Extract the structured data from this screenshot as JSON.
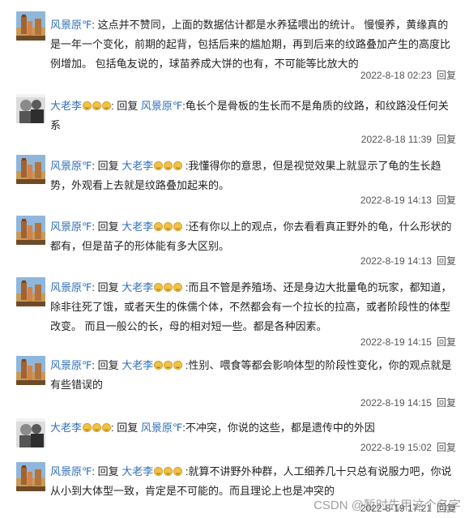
{
  "comments": [
    {
      "avatar": "landscape",
      "author": "风景原℉",
      "reply_prefix": "",
      "reply_to": "",
      "reply_to_emoji": 0,
      "sep": ": ",
      "text": "这点并不赞同，上面的数据估计都是水养猛喂出的统计。 慢慢养，黄缘真的是一年一个变化，前期的起背，包括后来的尴尬期，再到后来的纹路叠加产生的高度比例增加。 包括龟友说的，球苗养成大饼的也有，不可能等比放大的",
      "time": "2022-8-18 02:23",
      "reply": "回复"
    },
    {
      "avatar": "portrait",
      "author": "大老李",
      "author_emoji": 3,
      "reply_prefix": ": 回复 ",
      "reply_to": "风景原℉",
      "reply_to_emoji": 0,
      "sep": ":",
      "text": "龟长个是骨板的生长而不是角质的纹路，和纹路没任何关系",
      "time": "2022-8-18 11:39",
      "reply": "回复"
    },
    {
      "avatar": "landscape",
      "author": "风景原℉",
      "reply_prefix": ": 回复 ",
      "reply_to": "大老李",
      "reply_to_emoji": 3,
      "sep": " :",
      "text": "我懂得你的意思，但是视觉效果上就显示了龟的生长趋势，外观看上去就是纹路叠加起来的。",
      "time": "2022-8-19 14:13",
      "reply": "回复"
    },
    {
      "avatar": "landscape",
      "author": "风景原℉",
      "reply_prefix": ": 回复 ",
      "reply_to": "大老李",
      "reply_to_emoji": 3,
      "sep": " :",
      "text": "还有你以上的观点，你去看看真正野外的龟，什么形状的都有，但是苗子的形体能有多大区别。",
      "time": "2022-8-19 14:13",
      "reply": "回复"
    },
    {
      "avatar": "landscape",
      "author": "风景原℉",
      "reply_prefix": ": 回复 ",
      "reply_to": "大老李",
      "reply_to_emoji": 3,
      "sep": " :",
      "text": "而且不管是养殖场、还是身边大批量龟的玩家，都知道，除非往死了饿，或者天生的侏儒个体，不然都会有一个拉长的拉高，或者阶段性的体型改变。 而且一般公的长，母的相对短一些。都是各种因素。",
      "time": "2022-8-19 14:15",
      "reply": "回复"
    },
    {
      "avatar": "landscape",
      "author": "风景原℉",
      "reply_prefix": ": 回复 ",
      "reply_to": "大老李",
      "reply_to_emoji": 3,
      "sep": " :",
      "text": "性别、喂食等都会影响体型的阶段性变化，你的观点就是有些错误的",
      "time": "2022-8-19 14:15",
      "reply": "回复"
    },
    {
      "avatar": "portrait",
      "author": "大老李",
      "author_emoji": 3,
      "reply_prefix": ": 回复 ",
      "reply_to": "风景原℉",
      "reply_to_emoji": 0,
      "sep": ":",
      "text": "不冲突，你说的这些，都是遗传中的外因",
      "time": "2022-8-19 15:02",
      "reply": "回复"
    },
    {
      "avatar": "landscape",
      "author": "风景原℉",
      "reply_prefix": ": 回复 ",
      "reply_to": "大老李",
      "reply_to_emoji": 3,
      "sep": " :",
      "text": "就算不讲野外种群，人工细养几十只总有说服力吧，你说从小到大体型一致，肯定是不可能的。而且理论上也是冲突的",
      "time": "2022-8-19 17:21",
      "reply": "回复"
    }
  ],
  "watermark": "CSDN @暂时先用这个名字"
}
